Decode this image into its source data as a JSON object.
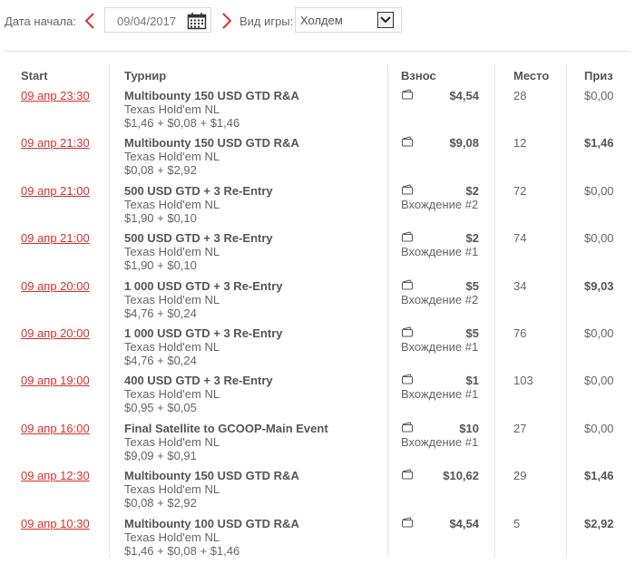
{
  "filters": {
    "start_date_label": "Дата начала:",
    "start_date_value": "09/04/2017",
    "game_label": "Вид игры:",
    "game_value": "Холдем"
  },
  "columns": {
    "start": "Start",
    "tournament": "Турнир",
    "buyin": "Взнос",
    "place": "Место",
    "prize": "Приз"
  },
  "colors": {
    "accent": "#d9302b",
    "text": "#666666",
    "border": "#e6e6e6"
  },
  "rows": [
    {
      "start": "09 апр 23:30",
      "name": "Multibounty 150 USD GTD R&A",
      "game": "Texas Hold'em NL",
      "fee": "$1,46 + $0,08 + $1,46",
      "buyin": "$4,54",
      "entry": "",
      "place": "28",
      "prize": "$0,00",
      "prize_bold": false
    },
    {
      "start": "09 апр 21:30",
      "name": "Multibounty 150 USD GTD R&A",
      "game": "Texas Hold'em NL",
      "fee": "$0,08 + $2,92",
      "buyin": "$9,08",
      "entry": "",
      "place": "12",
      "prize": "$1,46",
      "prize_bold": true
    },
    {
      "start": "09 апр 21:00",
      "name": "500 USD GTD + 3 Re-Entry",
      "game": "Texas Hold'em NL",
      "fee": "$1,90 + $0,10",
      "buyin": "$2",
      "entry": "Вхождение #2",
      "place": "72",
      "prize": "$0,00",
      "prize_bold": false
    },
    {
      "start": "09 апр 21:00",
      "name": "500 USD GTD + 3 Re-Entry",
      "game": "Texas Hold'em NL",
      "fee": "$1,90 + $0,10",
      "buyin": "$2",
      "entry": "Вхождение #1",
      "place": "74",
      "prize": "$0,00",
      "prize_bold": false
    },
    {
      "start": "09 апр 20:00",
      "name": "1 000 USD GTD + 3 Re-Entry",
      "game": "Texas Hold'em NL",
      "fee": "$4,76 + $0,24",
      "buyin": "$5",
      "entry": "Вхождение #2",
      "place": "34",
      "prize": "$9,03",
      "prize_bold": true
    },
    {
      "start": "09 апр 20:00",
      "name": "1 000 USD GTD + 3 Re-Entry",
      "game": "Texas Hold'em NL",
      "fee": "$4,76 + $0,24",
      "buyin": "$5",
      "entry": "Вхождение #1",
      "place": "76",
      "prize": "$0,00",
      "prize_bold": false
    },
    {
      "start": "09 апр 19:00",
      "name": "400 USD GTD + 3 Re-Entry",
      "game": "Texas Hold'em NL",
      "fee": "$0,95 + $0,05",
      "buyin": "$1",
      "entry": "Вхождение #1",
      "place": "103",
      "prize": "$0,00",
      "prize_bold": false
    },
    {
      "start": "09 апр 16:00",
      "name": "Final Satellite to GCOOP-Main Event",
      "game": "Texas Hold'em NL",
      "fee": "$9,09 + $0,91",
      "buyin": "$10",
      "entry": "Вхождение #1",
      "place": "27",
      "prize": "$0,00",
      "prize_bold": false
    },
    {
      "start": "09 апр 12:30",
      "name": "Multibounty 150 USD GTD R&A",
      "game": "Texas Hold'em NL",
      "fee": "$0,08 + $2,92",
      "buyin": "$10,62",
      "entry": "",
      "place": "29",
      "prize": "$1,46",
      "prize_bold": true
    },
    {
      "start": "09 апр 10:30",
      "name": "Multibounty 100 USD GTD R&A",
      "game": "Texas Hold'em NL",
      "fee": "$1,46 + $0,08 + $1,46",
      "buyin": "$4,54",
      "entry": "",
      "place": "5",
      "prize": "$2,92",
      "prize_bold": true
    }
  ]
}
